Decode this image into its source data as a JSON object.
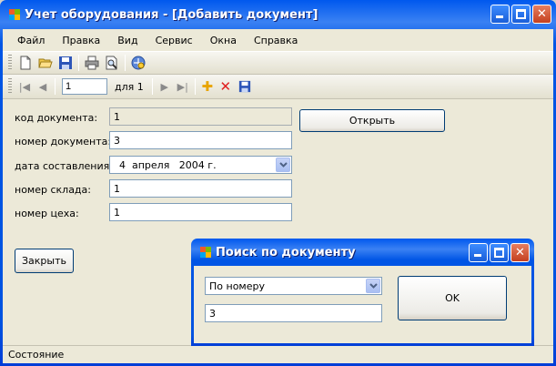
{
  "window": {
    "title": "Учет оборудования - [Добавить документ]",
    "minimize_glyph": "_",
    "close_glyph": "✕"
  },
  "menu": {
    "items": [
      "Файл",
      "Правка",
      "Вид",
      "Сервис",
      "Окна",
      "Справка"
    ]
  },
  "toolbar": {
    "icons": [
      "new-file-icon",
      "open-folder-icon",
      "save-icon",
      "print-icon",
      "print-preview-icon",
      "help-icon"
    ]
  },
  "navigator": {
    "first_glyph": "|◀",
    "prev_glyph": "◀",
    "position": "1",
    "count_label": "для 1",
    "next_glyph": "▶",
    "last_glyph": "▶|",
    "add_glyph": "✚",
    "delete_glyph": "✕"
  },
  "form": {
    "doc_code": {
      "label": "код документа:",
      "value": "1"
    },
    "doc_number": {
      "label": "номер документа:",
      "value": "3"
    },
    "doc_date": {
      "label": "дата составления:",
      "value": "4  апреля   2004 г."
    },
    "warehouse": {
      "label": "номер склада:",
      "value": "1"
    },
    "workshop": {
      "label": "номер цеха:",
      "value": "1"
    },
    "open_button": "Открыть",
    "close_button": "Закрыть"
  },
  "status": {
    "text": "Состояние"
  },
  "dialog": {
    "title": "Поиск по документу",
    "search_mode": "По номеру",
    "search_value": "3",
    "ok_button": "OK"
  },
  "colors": {
    "title_blue": "#0055e5",
    "client_bg": "#ece9d8",
    "close_red": "#c4401f",
    "field_border": "#7f9db9"
  }
}
